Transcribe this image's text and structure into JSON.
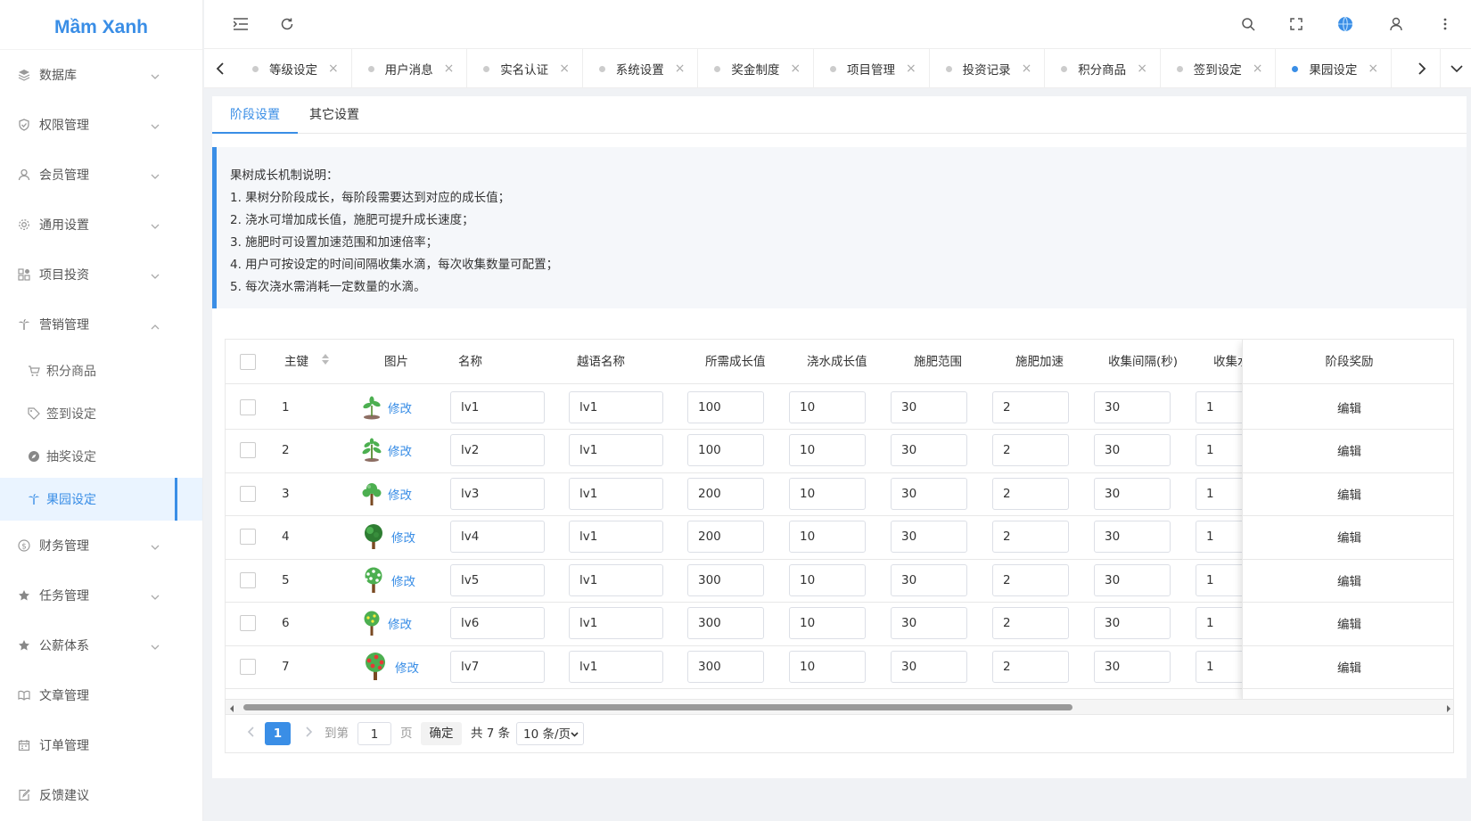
{
  "app": {
    "logo": "Mầm Xanh"
  },
  "sidebar": {
    "items": [
      {
        "label": "数据库",
        "icon": "layers-icon",
        "expanded": false
      },
      {
        "label": "权限管理",
        "icon": "shield-icon",
        "expanded": false
      },
      {
        "label": "会员管理",
        "icon": "user-icon",
        "expanded": false
      },
      {
        "label": "通用设置",
        "icon": "gear-icon",
        "expanded": false
      },
      {
        "label": "项目投资",
        "icon": "apps-icon",
        "expanded": false
      },
      {
        "label": "营销管理",
        "icon": "palm-icon",
        "expanded": true
      }
    ],
    "subitems": [
      {
        "label": "积分商品",
        "icon": "cart-icon"
      },
      {
        "label": "签到设定",
        "icon": "tag-icon"
      },
      {
        "label": "抽奖设定",
        "icon": "compass-icon"
      },
      {
        "label": "果园设定",
        "icon": "palm-icon",
        "active": true
      }
    ],
    "items_after": [
      {
        "label": "财务管理",
        "icon": "dollar-icon",
        "expanded": false
      },
      {
        "label": "任务管理",
        "icon": "star-icon",
        "expanded": false
      },
      {
        "label": "公薪体系",
        "icon": "star-icon",
        "expanded": false
      },
      {
        "label": "文章管理",
        "icon": "book-icon"
      },
      {
        "label": "订单管理",
        "icon": "calendar-icon"
      },
      {
        "label": "反馈建议",
        "icon": "edit-icon"
      }
    ]
  },
  "tabs": [
    {
      "label": "等级设定"
    },
    {
      "label": "用户消息"
    },
    {
      "label": "实名认证"
    },
    {
      "label": "系统设置"
    },
    {
      "label": "奖金制度"
    },
    {
      "label": "项目管理"
    },
    {
      "label": "投资记录"
    },
    {
      "label": "积分商品"
    },
    {
      "label": "签到设定"
    },
    {
      "label": "果园设定",
      "active": true
    }
  ],
  "subtabs": {
    "stage": "阶段设置",
    "other": "其它设置"
  },
  "notice": {
    "title": "果树成长机制说明：",
    "lines": [
      "1. 果树分阶段成长，每阶段需要达到对应的成长值；",
      "2. 浇水可增加成长值，施肥可提升成长速度；",
      "3. 施肥时可设置加速范围和加速倍率；",
      "4. 用户可按设定的时间间隔收集水滴，每次收集数量可配置；",
      "5. 每次浇水需消耗一定数量的水滴。"
    ]
  },
  "table": {
    "headers": {
      "id": "主键",
      "image": "图片",
      "name": "名称",
      "vi_name": "越语名称",
      "growth": "所需成长值",
      "water": "浇水成长值",
      "fert_range": "施肥范围",
      "fert_speed": "施肥加速",
      "interval": "收集间隔(秒)",
      "collect": "收集水",
      "reward": "阶段奖励"
    },
    "edit_image_label": "修改",
    "edit_label": "编辑",
    "rows": [
      {
        "id": "1",
        "name": "lv1",
        "vi_name": "lv1",
        "growth": "100",
        "water": "10",
        "fert_range": "30",
        "fert_speed": "2",
        "interval": "30",
        "collect": "1"
      },
      {
        "id": "2",
        "name": "lv2",
        "vi_name": "lv1",
        "growth": "100",
        "water": "10",
        "fert_range": "30",
        "fert_speed": "2",
        "interval": "30",
        "collect": "1"
      },
      {
        "id": "3",
        "name": "lv3",
        "vi_name": "lv1",
        "growth": "200",
        "water": "10",
        "fert_range": "30",
        "fert_speed": "2",
        "interval": "30",
        "collect": "1"
      },
      {
        "id": "4",
        "name": "lv4",
        "vi_name": "lv1",
        "growth": "200",
        "water": "10",
        "fert_range": "30",
        "fert_speed": "2",
        "interval": "30",
        "collect": "1"
      },
      {
        "id": "5",
        "name": "lv5",
        "vi_name": "lv1",
        "growth": "300",
        "water": "10",
        "fert_range": "30",
        "fert_speed": "2",
        "interval": "30",
        "collect": "1"
      },
      {
        "id": "6",
        "name": "lv6",
        "vi_name": "lv1",
        "growth": "300",
        "water": "10",
        "fert_range": "30",
        "fert_speed": "2",
        "interval": "30",
        "collect": "1"
      },
      {
        "id": "7",
        "name": "lv7",
        "vi_name": "lv1",
        "growth": "300",
        "water": "10",
        "fert_range": "30",
        "fert_speed": "2",
        "interval": "30",
        "collect": "1"
      }
    ]
  },
  "pagination": {
    "current": "1",
    "goto_label": "到第",
    "goto_value": "1",
    "page_label": "页",
    "confirm": "确定",
    "total": "共 7 条",
    "page_size": "10 条/页"
  },
  "colors": {
    "accent": "#3a8ee6",
    "tree_green": "#4caf50",
    "trunk": "#7a4a22"
  }
}
